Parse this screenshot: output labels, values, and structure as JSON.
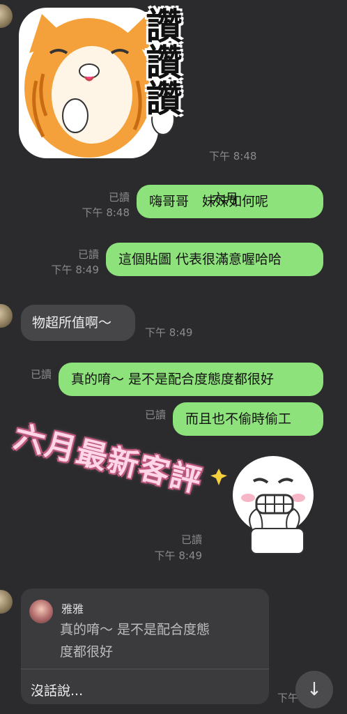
{
  "messages": {
    "m1_time": "下午 8:48",
    "m2_read": "已讀",
    "m2_time": "下午 8:48",
    "m2_text": "嗨哥哥　妹妹如何呢",
    "m2_sticker_label": "六月",
    "m3_read": "已讀",
    "m3_time": "下午 8:49",
    "m3_text": "這個貼圖 代表很滿意喔哈哈",
    "m4_text": "物超所值啊～",
    "m4_time": "下午 8:49",
    "m5_read": "已讀",
    "m5_text": "真的唷～ 是不是配合度態度都很好",
    "m6_read": "已讀",
    "m6_text": "而且也不偷時偷工",
    "m7_read": "已讀",
    "m7_time": "下午 8:49",
    "cat_sticker_text": "讚讚讚",
    "overlay_text": "六月最新客評"
  },
  "reply": {
    "name": "雅雅",
    "quote_line1": "真的唷～ 是不是配合度態",
    "quote_line2": "度都很好",
    "answer": "沒話說...",
    "time_partial": "下午"
  },
  "icons": {
    "scroll_down": "arrow-down-icon"
  },
  "colors": {
    "background": "#2b2b2d",
    "bubble_green": "#8ee27b",
    "bubble_dark": "#464649"
  }
}
